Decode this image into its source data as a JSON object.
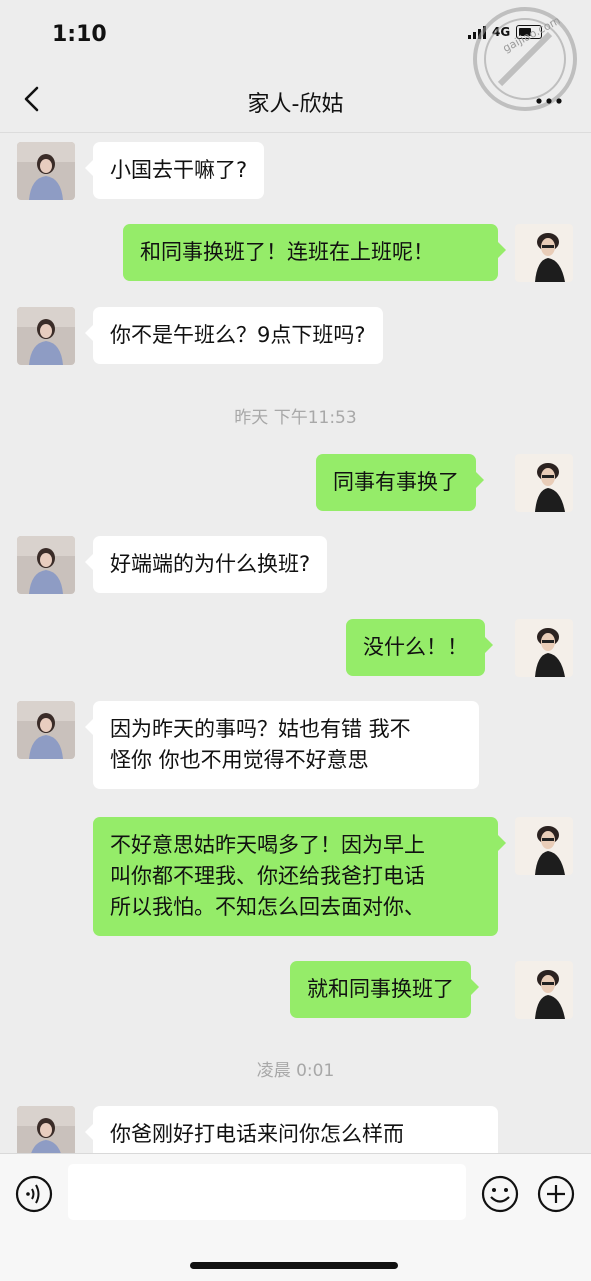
{
  "status_bar": {
    "time": "1:10",
    "network": "4G"
  },
  "watermark": {
    "text": "gaijiao.com"
  },
  "nav": {
    "title": "家人-欣姑",
    "back_icon": "chevron-left-icon",
    "more_icon": "ellipsis-icon"
  },
  "messages": [
    {
      "side": "in",
      "text": "小国去干嘛了?"
    },
    {
      "side": "out",
      "text": "和同事换班了！连班在上班呢！"
    },
    {
      "side": "in",
      "text": "你不是午班么？9点下班吗?"
    },
    {
      "side": "time",
      "text": "昨天 下午11:53"
    },
    {
      "side": "out",
      "text": "同事有事换了"
    },
    {
      "side": "in",
      "text": "好端端的为什么换班?"
    },
    {
      "side": "out",
      "text": "没什么！！"
    },
    {
      "side": "in",
      "text": "因为昨天的事吗？姑也有错 我不\n怪你 你也不用觉得不好意思"
    },
    {
      "side": "out",
      "text": "不好意思姑昨天喝多了！因为早上\n叫你都不理我、你还给我爸打电话\n所以我怕。不知怎么回去面对你、"
    },
    {
      "side": "out",
      "text": "就和同事换班了"
    },
    {
      "side": "time",
      "text": "凌晨 0:01"
    },
    {
      "side": "in",
      "text": "你爸刚好打电话来问你怎么样而"
    }
  ],
  "input_bar": {
    "voice_icon": "voice-icon",
    "emoji_icon": "emoji-icon",
    "plus_icon": "plus-icon",
    "placeholder": ""
  },
  "colors": {
    "background": "#ededed",
    "incoming_bubble": "#ffffff",
    "outgoing_bubble": "#95ec69"
  }
}
